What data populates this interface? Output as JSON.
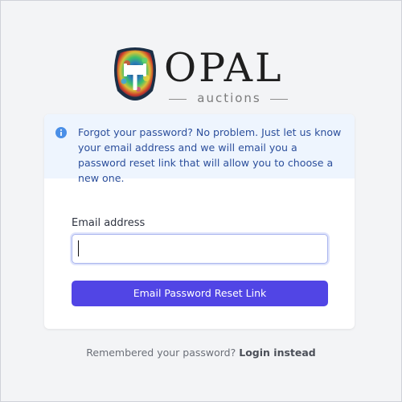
{
  "brand": {
    "name": "OPAL",
    "tagline": "auctions",
    "colors": {
      "accent": "#5145e5",
      "notice_bg": "#eef5fe",
      "notice_text": "#2c4f9c",
      "info_icon": "#4a8fe7"
    }
  },
  "notice": {
    "icon": "info-icon",
    "text": "Forgot your password? No problem. Just let us know your email address and we will email you a password reset link that will allow you to choose a new one."
  },
  "form": {
    "email_label": "Email address",
    "email_value": "",
    "email_placeholder": "",
    "submit_label": "Email Password Reset Link"
  },
  "footer": {
    "prompt": "Remembered your password?",
    "link_label": "Login instead"
  }
}
